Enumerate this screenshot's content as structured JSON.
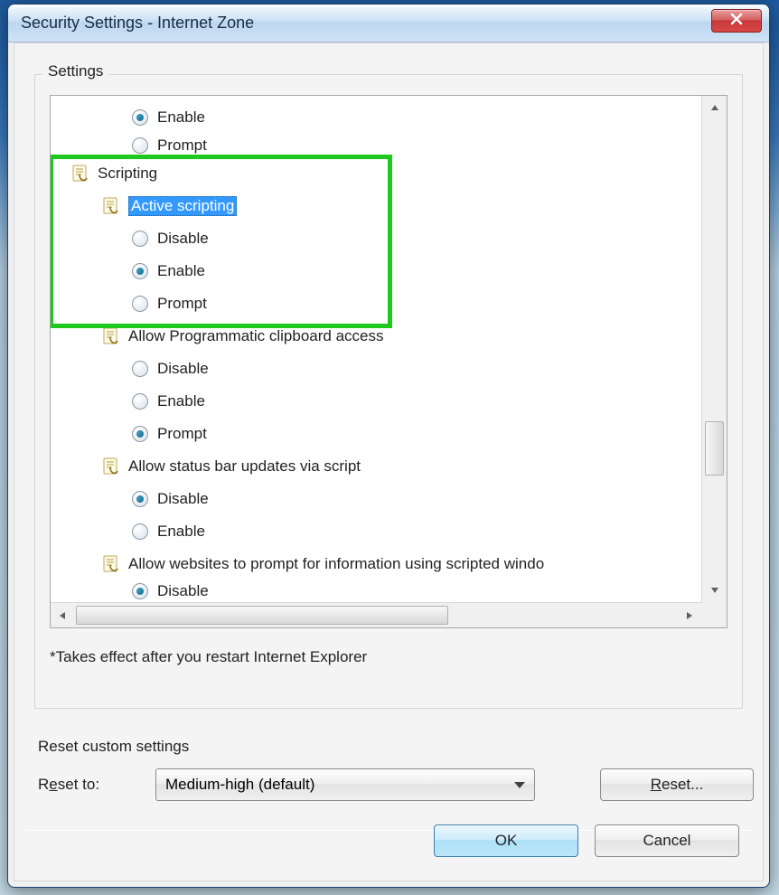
{
  "window": {
    "title": "Security Settings - Internet Zone"
  },
  "group": {
    "label": "Settings",
    "footnote": "*Takes effect after you restart Internet Explorer"
  },
  "tree": {
    "rows": [
      {
        "indent": 3,
        "type": "radio",
        "checked": true,
        "label": "Enable"
      },
      {
        "indent": 3,
        "type": "radio",
        "checked": false,
        "label": "Prompt",
        "clipped": true
      },
      {
        "indent": 1,
        "type": "section",
        "label": "Scripting"
      },
      {
        "indent": 2,
        "type": "item",
        "label": "Active scripting",
        "selected": true
      },
      {
        "indent": 3,
        "type": "radio",
        "checked": false,
        "label": "Disable"
      },
      {
        "indent": 3,
        "type": "radio",
        "checked": true,
        "label": "Enable"
      },
      {
        "indent": 3,
        "type": "radio",
        "checked": false,
        "label": "Prompt"
      },
      {
        "indent": 2,
        "type": "item",
        "label": "Allow Programmatic clipboard access"
      },
      {
        "indent": 3,
        "type": "radio",
        "checked": false,
        "label": "Disable"
      },
      {
        "indent": 3,
        "type": "radio",
        "checked": false,
        "label": "Enable"
      },
      {
        "indent": 3,
        "type": "radio",
        "checked": true,
        "label": "Prompt"
      },
      {
        "indent": 2,
        "type": "item",
        "label": "Allow status bar updates via script"
      },
      {
        "indent": 3,
        "type": "radio",
        "checked": true,
        "label": "Disable"
      },
      {
        "indent": 3,
        "type": "radio",
        "checked": false,
        "label": "Enable"
      },
      {
        "indent": 2,
        "type": "item",
        "label": "Allow websites to prompt for information using scripted windo"
      },
      {
        "indent": 3,
        "type": "radio",
        "checked": true,
        "label": "Disable",
        "clipped": true
      }
    ]
  },
  "reset": {
    "section_label": "Reset custom settings",
    "to_label_pre": "R",
    "to_label_ul": "e",
    "to_label_post": "set to:",
    "combo_value": "Medium-high (default)",
    "button_ul": "R",
    "button_post": "eset..."
  },
  "dialog": {
    "ok": "OK",
    "cancel": "Cancel"
  },
  "colors": {
    "highlight": "#1ec81e",
    "selection": "#3399ff"
  }
}
